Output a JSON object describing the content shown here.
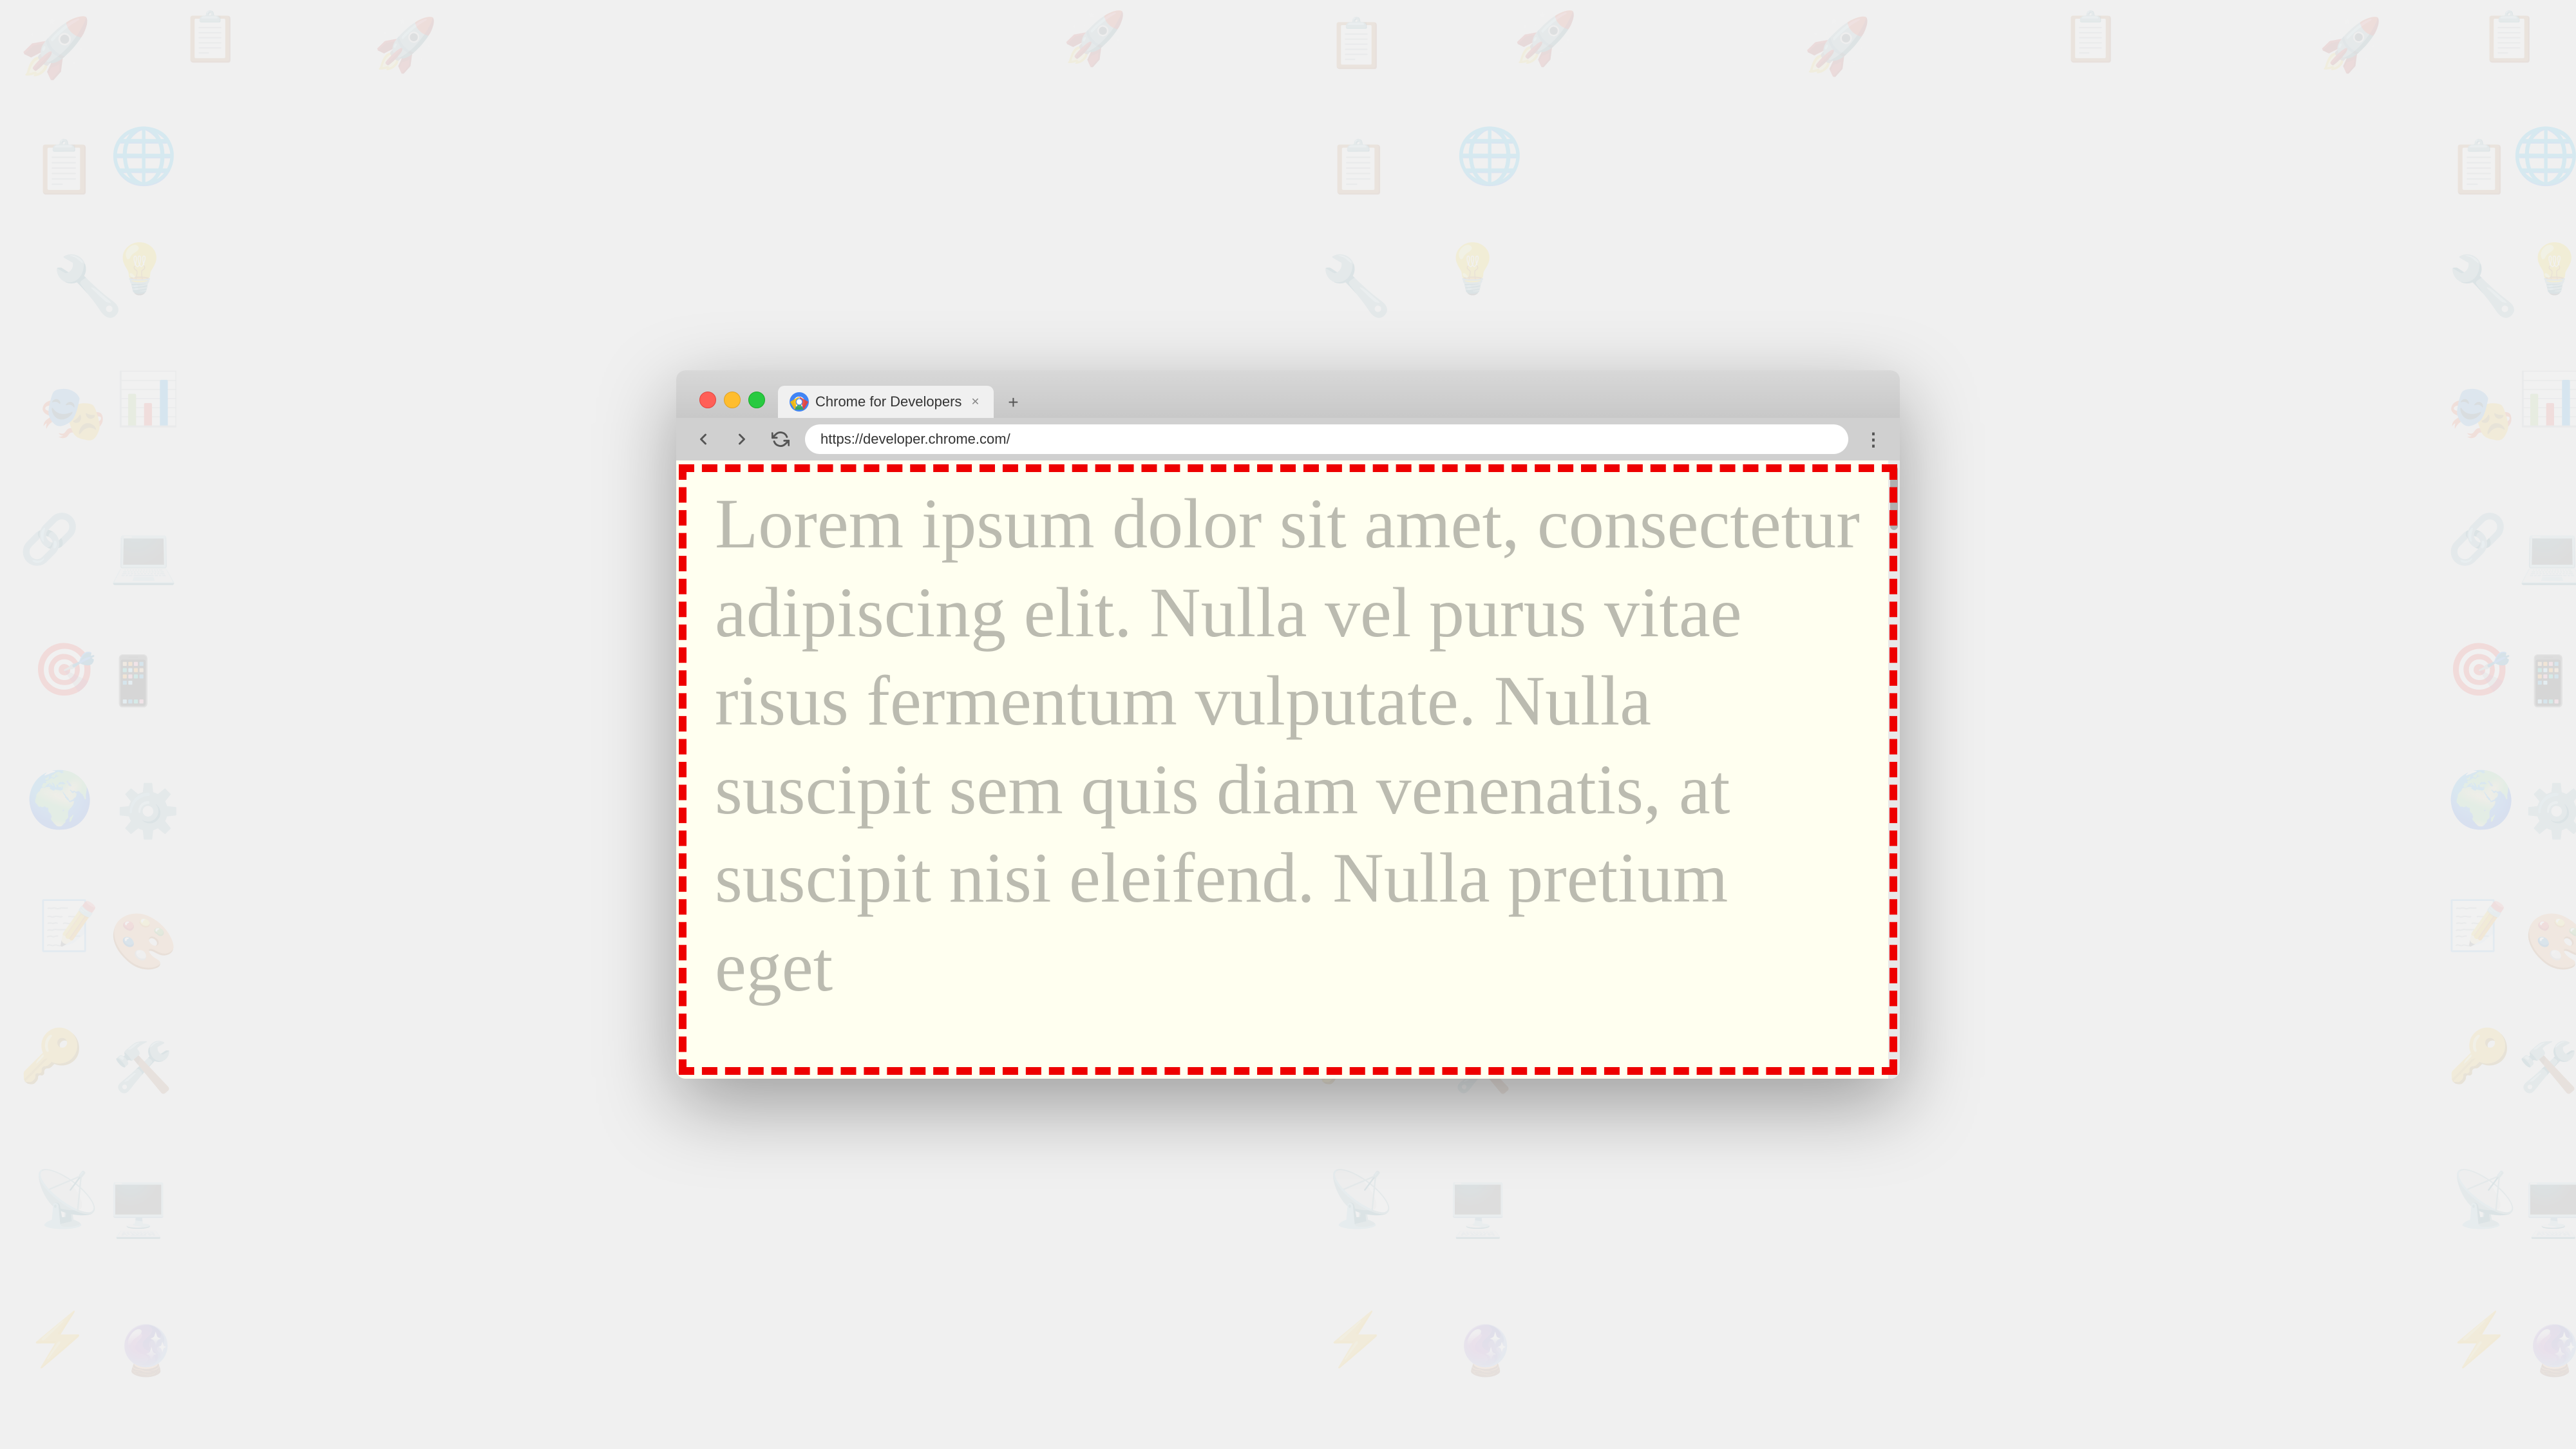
{
  "background": {
    "color": "#f0f0f0"
  },
  "browser": {
    "tab": {
      "title": "Chrome for Developers",
      "favicon": "chrome-logo"
    },
    "new_tab_label": "+",
    "address_bar": {
      "url": "https://developer.chrome.com/",
      "placeholder": "Search or enter web address"
    },
    "nav": {
      "back_title": "Back",
      "forward_title": "Forward",
      "reload_title": "Reload"
    },
    "menu_icon": "⋮"
  },
  "content": {
    "background": "#fffff0",
    "lorem_text": "Lorem ipsum dolor sit amet, consectetur adipiscing elit. Nulla vel purus vitae risus fermentum vulputate. Nulla suscipit sem quis diam venenatis, at suscipit nisi eleifend. Nulla pretium eget",
    "border_color": "#dd0000",
    "text_color": "#bbbbbb"
  },
  "traffic_lights": {
    "close_color": "#ff5f57",
    "minimize_color": "#ffbd2e",
    "maximize_color": "#28ca41"
  }
}
